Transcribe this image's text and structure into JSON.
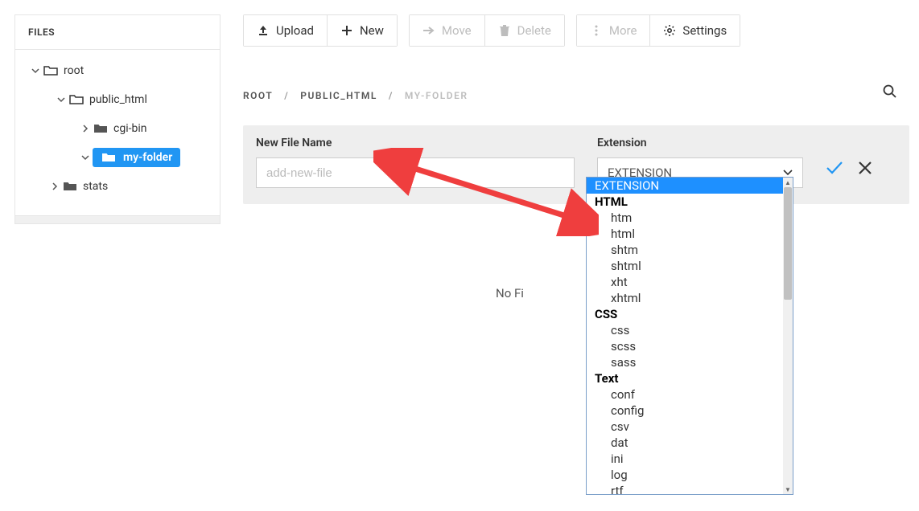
{
  "sidebar": {
    "header": "FILES",
    "tree": {
      "root": "root",
      "public_html": "public_html",
      "cgi_bin": "cgi-bin",
      "my_folder": "my-folder",
      "stats": "stats"
    }
  },
  "toolbar": {
    "upload": "Upload",
    "new": "New",
    "move": "Move",
    "delete": "Delete",
    "more": "More",
    "settings": "Settings"
  },
  "breadcrumb": {
    "c1": "ROOT",
    "c2": "PUBLIC_HTML",
    "c3": "MY-FOLDER"
  },
  "panel": {
    "name_label": "New File Name",
    "name_placeholder": "add-new-file",
    "ext_label": "Extension",
    "ext_value": "EXTENSION"
  },
  "dropdown": {
    "top": "EXTENSION",
    "groups": [
      {
        "label": "HTML",
        "items": [
          "htm",
          "html",
          "shtm",
          "shtml",
          "xht",
          "xhtml"
        ]
      },
      {
        "label": "CSS",
        "items": [
          "css",
          "scss",
          "sass"
        ]
      },
      {
        "label": "Text",
        "items": [
          "conf",
          "config",
          "csv",
          "dat",
          "ini",
          "log",
          "rtf"
        ]
      }
    ]
  },
  "main": {
    "no_files": "No Fi"
  }
}
